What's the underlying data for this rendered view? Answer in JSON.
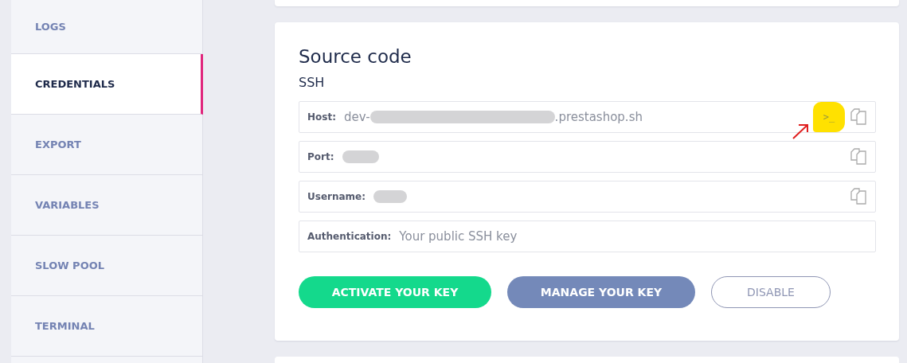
{
  "sidebar": {
    "items": [
      {
        "label": "LOGS",
        "selected": false
      },
      {
        "label": "CREDENTIALS",
        "selected": true
      },
      {
        "label": "EXPORT",
        "selected": false
      },
      {
        "label": "VARIABLES",
        "selected": false
      },
      {
        "label": "SLOW POOL",
        "selected": false
      },
      {
        "label": "TERMINAL",
        "selected": false
      }
    ]
  },
  "card": {
    "title": "Source code",
    "subtitle": "SSH",
    "fields": [
      {
        "label": "Host:",
        "value_parts": [
          "dev-",
          ".prestashop.sh"
        ],
        "redacted": true,
        "terminal": true,
        "terminal_label": ">_",
        "copy": true
      },
      {
        "label": "Port:",
        "redacted": true,
        "terminal": false,
        "copy": true
      },
      {
        "label": "Username:",
        "redacted": true,
        "terminal": false,
        "copy": true
      },
      {
        "label": "Authentication:",
        "value_parts": [
          "Your public SSH key"
        ],
        "redacted": false,
        "terminal": false,
        "copy": false
      }
    ],
    "buttons": [
      {
        "label": "ACTIVATE YOUR KEY",
        "kind": "primary"
      },
      {
        "label": "MANAGE YOUR KEY",
        "kind": "secondary"
      },
      {
        "label": "DISABLE",
        "kind": "outline"
      }
    ]
  }
}
